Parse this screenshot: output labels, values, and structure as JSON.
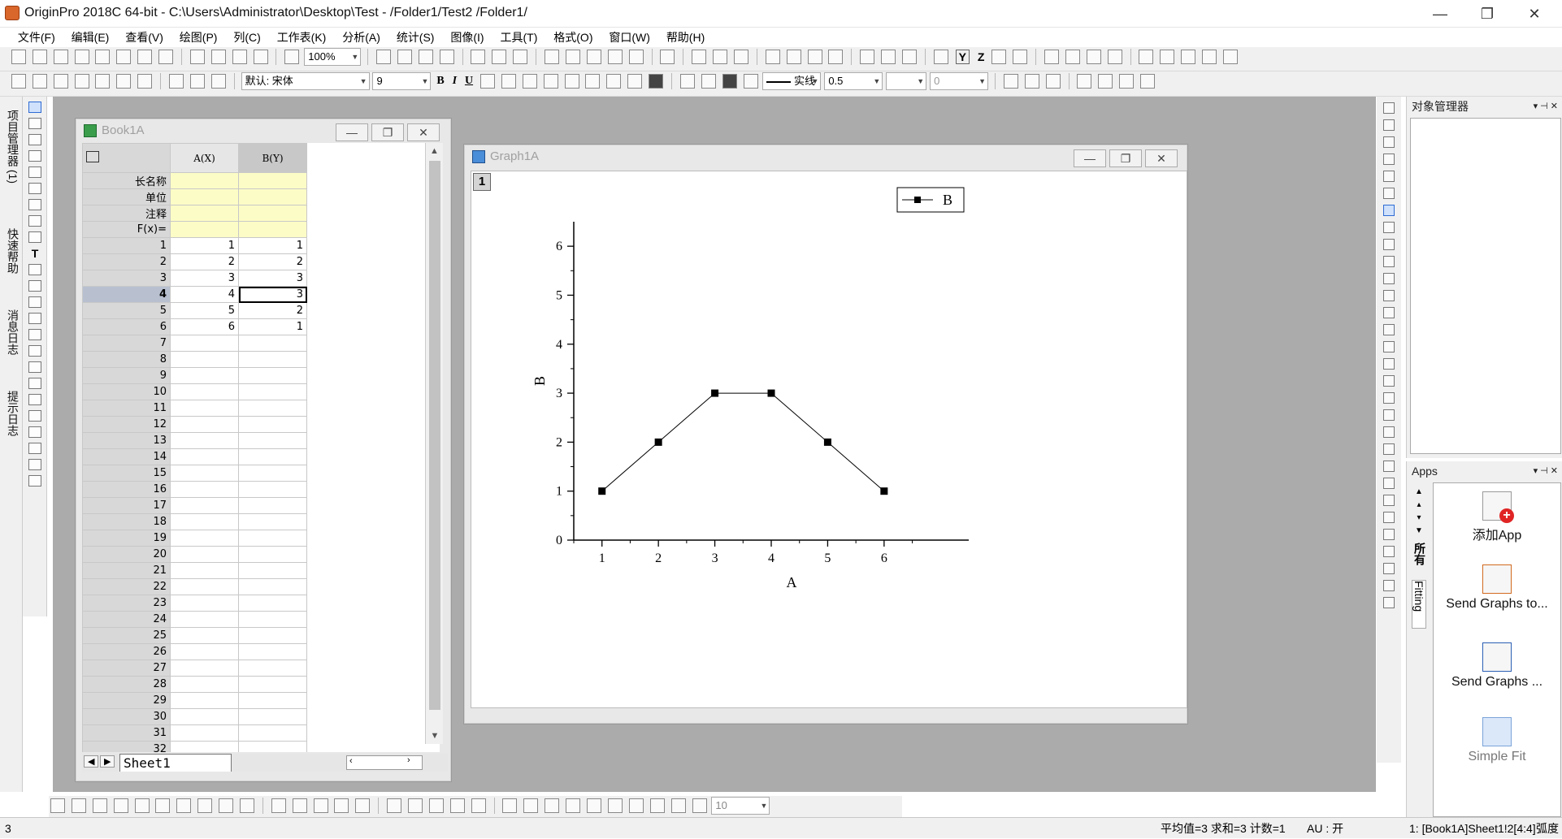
{
  "titlebar": {
    "title": "OriginPro 2018C 64-bit - C:\\Users\\Administrator\\Desktop\\Test - /Folder1/Test2 /Folder1/",
    "minimize": "—",
    "restore": "❐",
    "close": "✕"
  },
  "menu": [
    "文件(F)",
    "编辑(E)",
    "查看(V)",
    "绘图(P)",
    "列(C)",
    "工作表(K)",
    "分析(A)",
    "统计(S)",
    "图像(I)",
    "工具(T)",
    "格式(O)",
    "窗口(W)",
    "帮助(H)"
  ],
  "toolbar": {
    "zoom": "100%",
    "font_name": "默认: 宋体",
    "font_size": "9",
    "bold": "B",
    "italic": "I",
    "underline": "U",
    "line_style": "实线",
    "line_width": "0.5",
    "arrow_value": "0",
    "y_button": "Y",
    "z_button": "Z"
  },
  "left_panels": [
    "项目管理器 (1)",
    "快速帮助",
    "消息日志",
    "提示日志"
  ],
  "book": {
    "title": "Book1A",
    "col_a": "A(X)",
    "col_b": "B(Y)",
    "meta_rows": [
      "长名称",
      "单位",
      "注释",
      "F(x)="
    ],
    "rows": [
      {
        "n": "1",
        "a": "1",
        "b": "1"
      },
      {
        "n": "2",
        "a": "2",
        "b": "2"
      },
      {
        "n": "3",
        "a": "3",
        "b": "3"
      },
      {
        "n": "4",
        "a": "4",
        "b": "3"
      },
      {
        "n": "5",
        "a": "5",
        "b": "2"
      },
      {
        "n": "6",
        "a": "6",
        "b": "1"
      },
      {
        "n": "7",
        "a": "",
        "b": ""
      },
      {
        "n": "8",
        "a": "",
        "b": ""
      },
      {
        "n": "9",
        "a": "",
        "b": ""
      },
      {
        "n": "10",
        "a": "",
        "b": ""
      },
      {
        "n": "11",
        "a": "",
        "b": ""
      },
      {
        "n": "12",
        "a": "",
        "b": ""
      },
      {
        "n": "13",
        "a": "",
        "b": ""
      },
      {
        "n": "14",
        "a": "",
        "b": ""
      },
      {
        "n": "15",
        "a": "",
        "b": ""
      },
      {
        "n": "16",
        "a": "",
        "b": ""
      },
      {
        "n": "17",
        "a": "",
        "b": ""
      },
      {
        "n": "18",
        "a": "",
        "b": ""
      },
      {
        "n": "19",
        "a": "",
        "b": ""
      },
      {
        "n": "20",
        "a": "",
        "b": ""
      },
      {
        "n": "21",
        "a": "",
        "b": ""
      },
      {
        "n": "22",
        "a": "",
        "b": ""
      },
      {
        "n": "23",
        "a": "",
        "b": ""
      },
      {
        "n": "24",
        "a": "",
        "b": ""
      },
      {
        "n": "25",
        "a": "",
        "b": ""
      },
      {
        "n": "26",
        "a": "",
        "b": ""
      },
      {
        "n": "27",
        "a": "",
        "b": ""
      },
      {
        "n": "28",
        "a": "",
        "b": ""
      },
      {
        "n": "29",
        "a": "",
        "b": ""
      },
      {
        "n": "30",
        "a": "",
        "b": ""
      },
      {
        "n": "31",
        "a": "",
        "b": ""
      },
      {
        "n": "32",
        "a": "",
        "b": ""
      }
    ],
    "sheet_tab": "Sheet1"
  },
  "graph": {
    "title": "Graph1A",
    "layer": "1"
  },
  "chart_data": {
    "type": "line",
    "x": [
      1,
      2,
      3,
      4,
      5,
      6
    ],
    "series": [
      {
        "name": "B",
        "values": [
          1,
          2,
          3,
          3,
          2,
          1
        ]
      }
    ],
    "xlabel": "A",
    "ylabel": "B",
    "xticks": [
      "1",
      "2",
      "3",
      "4",
      "5",
      "6"
    ],
    "yticks": [
      "0",
      "1",
      "2",
      "3",
      "4",
      "5",
      "6"
    ],
    "xlim": [
      0.5,
      7.5
    ],
    "ylim": [
      0,
      6.5
    ],
    "legend": "top-right",
    "marker": "square",
    "color": "#000000"
  },
  "object_manager": {
    "title": "对象管理器"
  },
  "apps": {
    "title": "Apps",
    "tabs": [
      "所有",
      "Fitting"
    ],
    "items": [
      "添加App",
      "Send Graphs to...",
      "Send Graphs ...",
      "Simple Fit"
    ]
  },
  "bottom_toolbar": {
    "value": "10"
  },
  "status": {
    "left": "3",
    "stats": "平均值=3 求和=3 计数=1",
    "au": "AU : 开",
    "cell": "1: [Book1A]Sheet1!2[4:4]",
    "unit": "弧度"
  }
}
